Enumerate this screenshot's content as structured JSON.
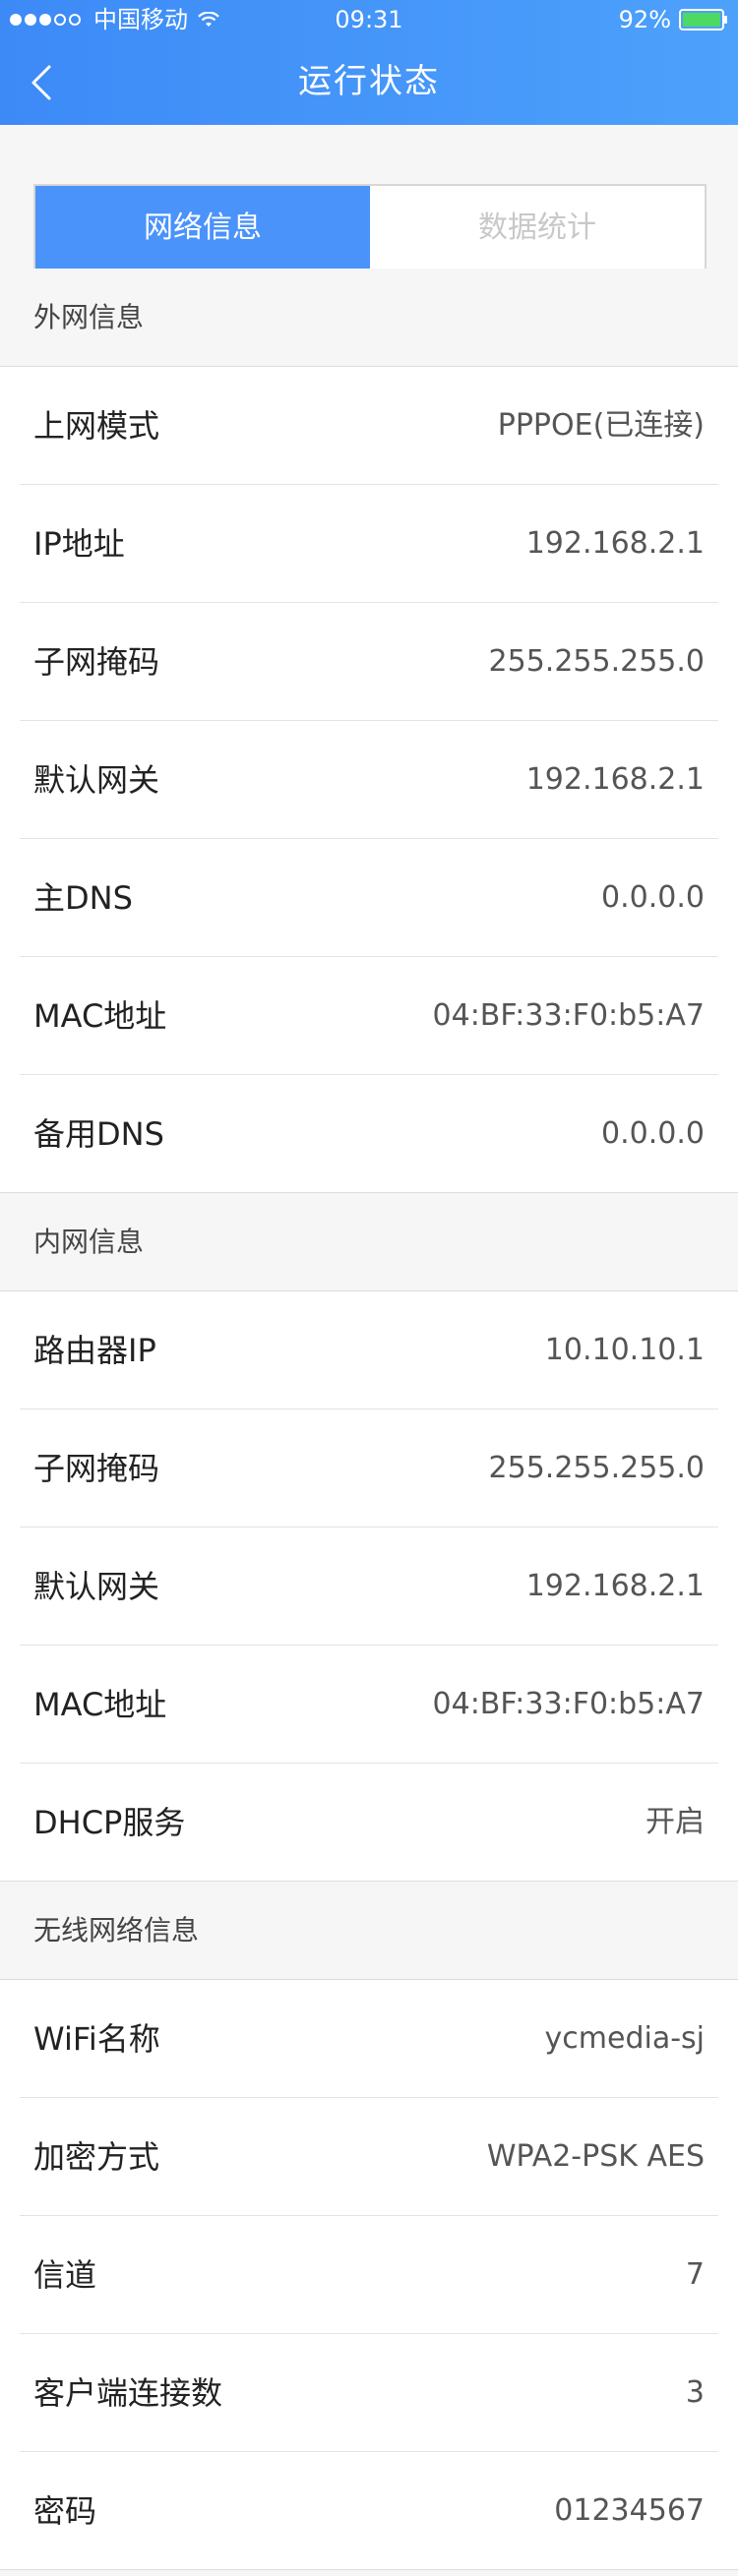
{
  "status_bar": {
    "carrier": "中国移动",
    "time": "09:31",
    "battery": "92%"
  },
  "nav": {
    "title": "运行状态",
    "back_icon": "chevron-left-icon"
  },
  "tabs": [
    {
      "label": "网络信息",
      "active": true
    },
    {
      "label": "数据统计",
      "active": false
    }
  ],
  "colors": {
    "accent": "#4a93fb",
    "nav_gradient_start": "#3d8af7",
    "nav_gradient_end": "#4da1fb"
  },
  "sections": {
    "wan": {
      "title": "外网信息",
      "rows": [
        {
          "label": "上网模式",
          "value": "PPPOE(已连接)"
        },
        {
          "label": "IP地址",
          "value": "192.168.2.1"
        },
        {
          "label": "子网掩码",
          "value": "255.255.255.0"
        },
        {
          "label": "默认网关",
          "value": "192.168.2.1"
        },
        {
          "label": "主DNS",
          "value": "0.0.0.0"
        },
        {
          "label": "MAC地址",
          "value": "04:BF:33:F0:b5:A7"
        },
        {
          "label": "备用DNS",
          "value": "0.0.0.0"
        }
      ]
    },
    "lan": {
      "title": "内网信息",
      "rows": [
        {
          "label": "路由器IP",
          "value": "10.10.10.1"
        },
        {
          "label": "子网掩码",
          "value": "255.255.255.0"
        },
        {
          "label": "默认网关",
          "value": "192.168.2.1"
        },
        {
          "label": "MAC地址",
          "value": "04:BF:33:F0:b5:A7"
        },
        {
          "label": "DHCP服务",
          "value": "开启"
        }
      ]
    },
    "wifi": {
      "title": "无线网络信息",
      "rows": [
        {
          "label": "WiFi名称",
          "value": "ycmedia-sj"
        },
        {
          "label": "加密方式",
          "value": "WPA2-PSK AES"
        },
        {
          "label": "信道",
          "value": "7"
        },
        {
          "label": "客户端连接数",
          "value": "3"
        },
        {
          "label": "密码",
          "value": "01234567"
        }
      ]
    }
  }
}
